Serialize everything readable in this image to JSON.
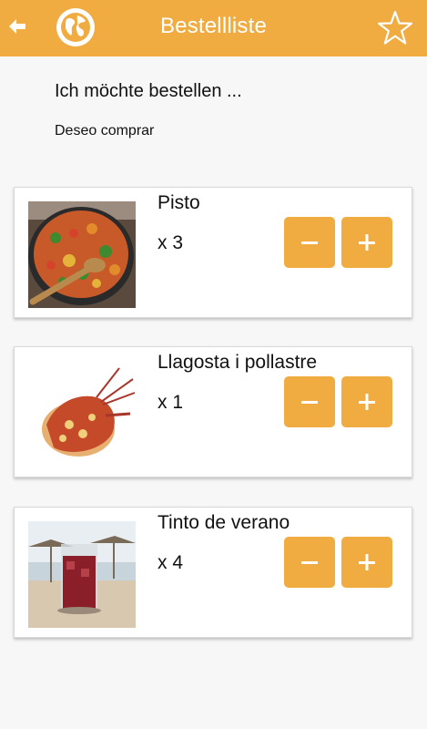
{
  "header": {
    "title": "Bestellliste",
    "back_icon": "arrow-left-icon",
    "globe_icon": "globe-icon",
    "favorite_icon": "star-outline-icon",
    "bar_color": "#f0ac40"
  },
  "intro": {
    "primary": "Ich möchte bestellen ...",
    "secondary": "Deseo comprar"
  },
  "items": [
    {
      "name": "Pisto",
      "qty": "x 3"
    },
    {
      "name": "Llagosta i pollastre",
      "qty": "x 1"
    },
    {
      "name": "Tinto de verano",
      "qty": "x 4"
    }
  ],
  "controls": {
    "decrement_icon": "minus-icon",
    "increment_icon": "plus-icon",
    "button_color": "#f0ac40"
  }
}
